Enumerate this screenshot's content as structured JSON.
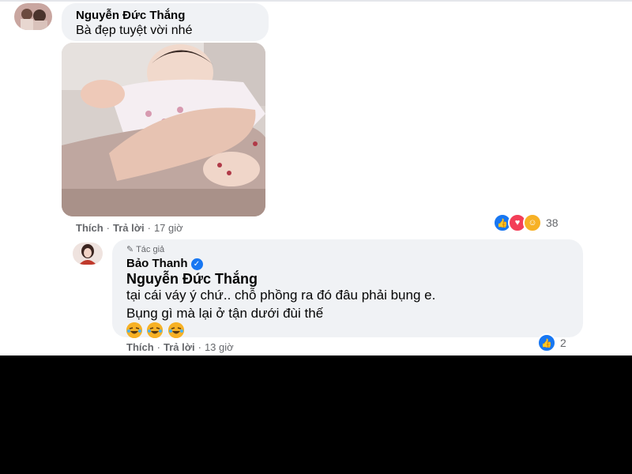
{
  "comment1": {
    "author": "Nguyễn Đức Thắng",
    "text": "Bà đẹp tuyệt vời nhé",
    "actions": {
      "like": "Thích",
      "reply": "Trả lời",
      "time": "17 giờ"
    },
    "reactions": {
      "icons": [
        "like-icon",
        "love-icon",
        "haha-icon"
      ],
      "count": "38"
    }
  },
  "reply1": {
    "badge": "Tác giả",
    "author": "Bảo Thanh",
    "mention": "Nguyễn Đức Thắng",
    "line1": "tại cái váy ý chứ.. chỗ phồng ra đó đâu phải bụng e.",
    "line2": "Bụng gì mà lại ở tận dưới đùi thế",
    "emojis": [
      "haha-emoji",
      "haha-emoji",
      "haha-emoji"
    ],
    "actions": {
      "like": "Thích",
      "reply": "Trả lời",
      "time": "13 giờ"
    },
    "reactions": {
      "icons": [
        "like-icon"
      ],
      "count": "2"
    }
  },
  "colors": {
    "bubble": "#f0f2f5",
    "meta": "#65676b",
    "accent": "#1877f2"
  }
}
